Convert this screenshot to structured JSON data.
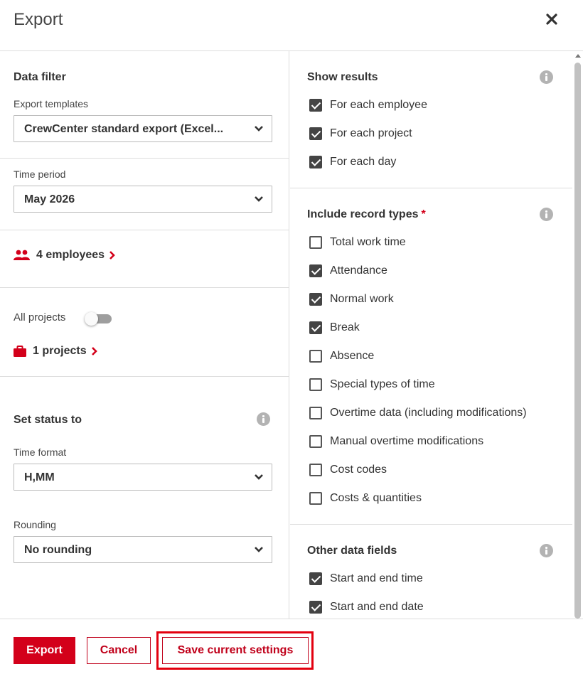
{
  "dialog": {
    "title": "Export",
    "close_icon": "close-icon"
  },
  "left": {
    "data_filter_title": "Data filter",
    "export_templates_label": "Export templates",
    "export_templates_value": "CrewCenter standard export (Excel...",
    "time_period_label": "Time period",
    "time_period_value": "May 2026",
    "employees_link": "4 employees",
    "all_projects_label": "All projects",
    "all_projects_on": false,
    "projects_link": "1 projects",
    "set_status_title": "Set status to",
    "time_format_label": "Time format",
    "time_format_value": "H,MM",
    "rounding_label": "Rounding",
    "rounding_value": "No rounding"
  },
  "right": {
    "show_results": {
      "title": "Show results",
      "items": [
        {
          "label": "For each employee",
          "checked": true
        },
        {
          "label": "For each project",
          "checked": true
        },
        {
          "label": "For each day",
          "checked": true
        }
      ]
    },
    "record_types": {
      "title": "Include record types",
      "required_mark": "*",
      "items": [
        {
          "label": "Total work time",
          "checked": false
        },
        {
          "label": "Attendance",
          "checked": true
        },
        {
          "label": "Normal work",
          "checked": true
        },
        {
          "label": "Break",
          "checked": true
        },
        {
          "label": "Absence",
          "checked": false
        },
        {
          "label": "Special types of time",
          "checked": false
        },
        {
          "label": "Overtime data (including modifications)",
          "checked": false
        },
        {
          "label": "Manual overtime modifications",
          "checked": false
        },
        {
          "label": "Cost codes",
          "checked": false
        },
        {
          "label": "Costs & quantities",
          "checked": false
        }
      ]
    },
    "other_fields": {
      "title": "Other data fields",
      "items": [
        {
          "label": "Start and end time",
          "checked": true
        },
        {
          "label": "Start and end date",
          "checked": true
        }
      ]
    }
  },
  "footer": {
    "export_label": "Export",
    "cancel_label": "Cancel",
    "save_label": "Save current settings"
  },
  "colors": {
    "accent": "#d3001a",
    "checkbox": "#444444",
    "info": "#b3b3b3"
  }
}
